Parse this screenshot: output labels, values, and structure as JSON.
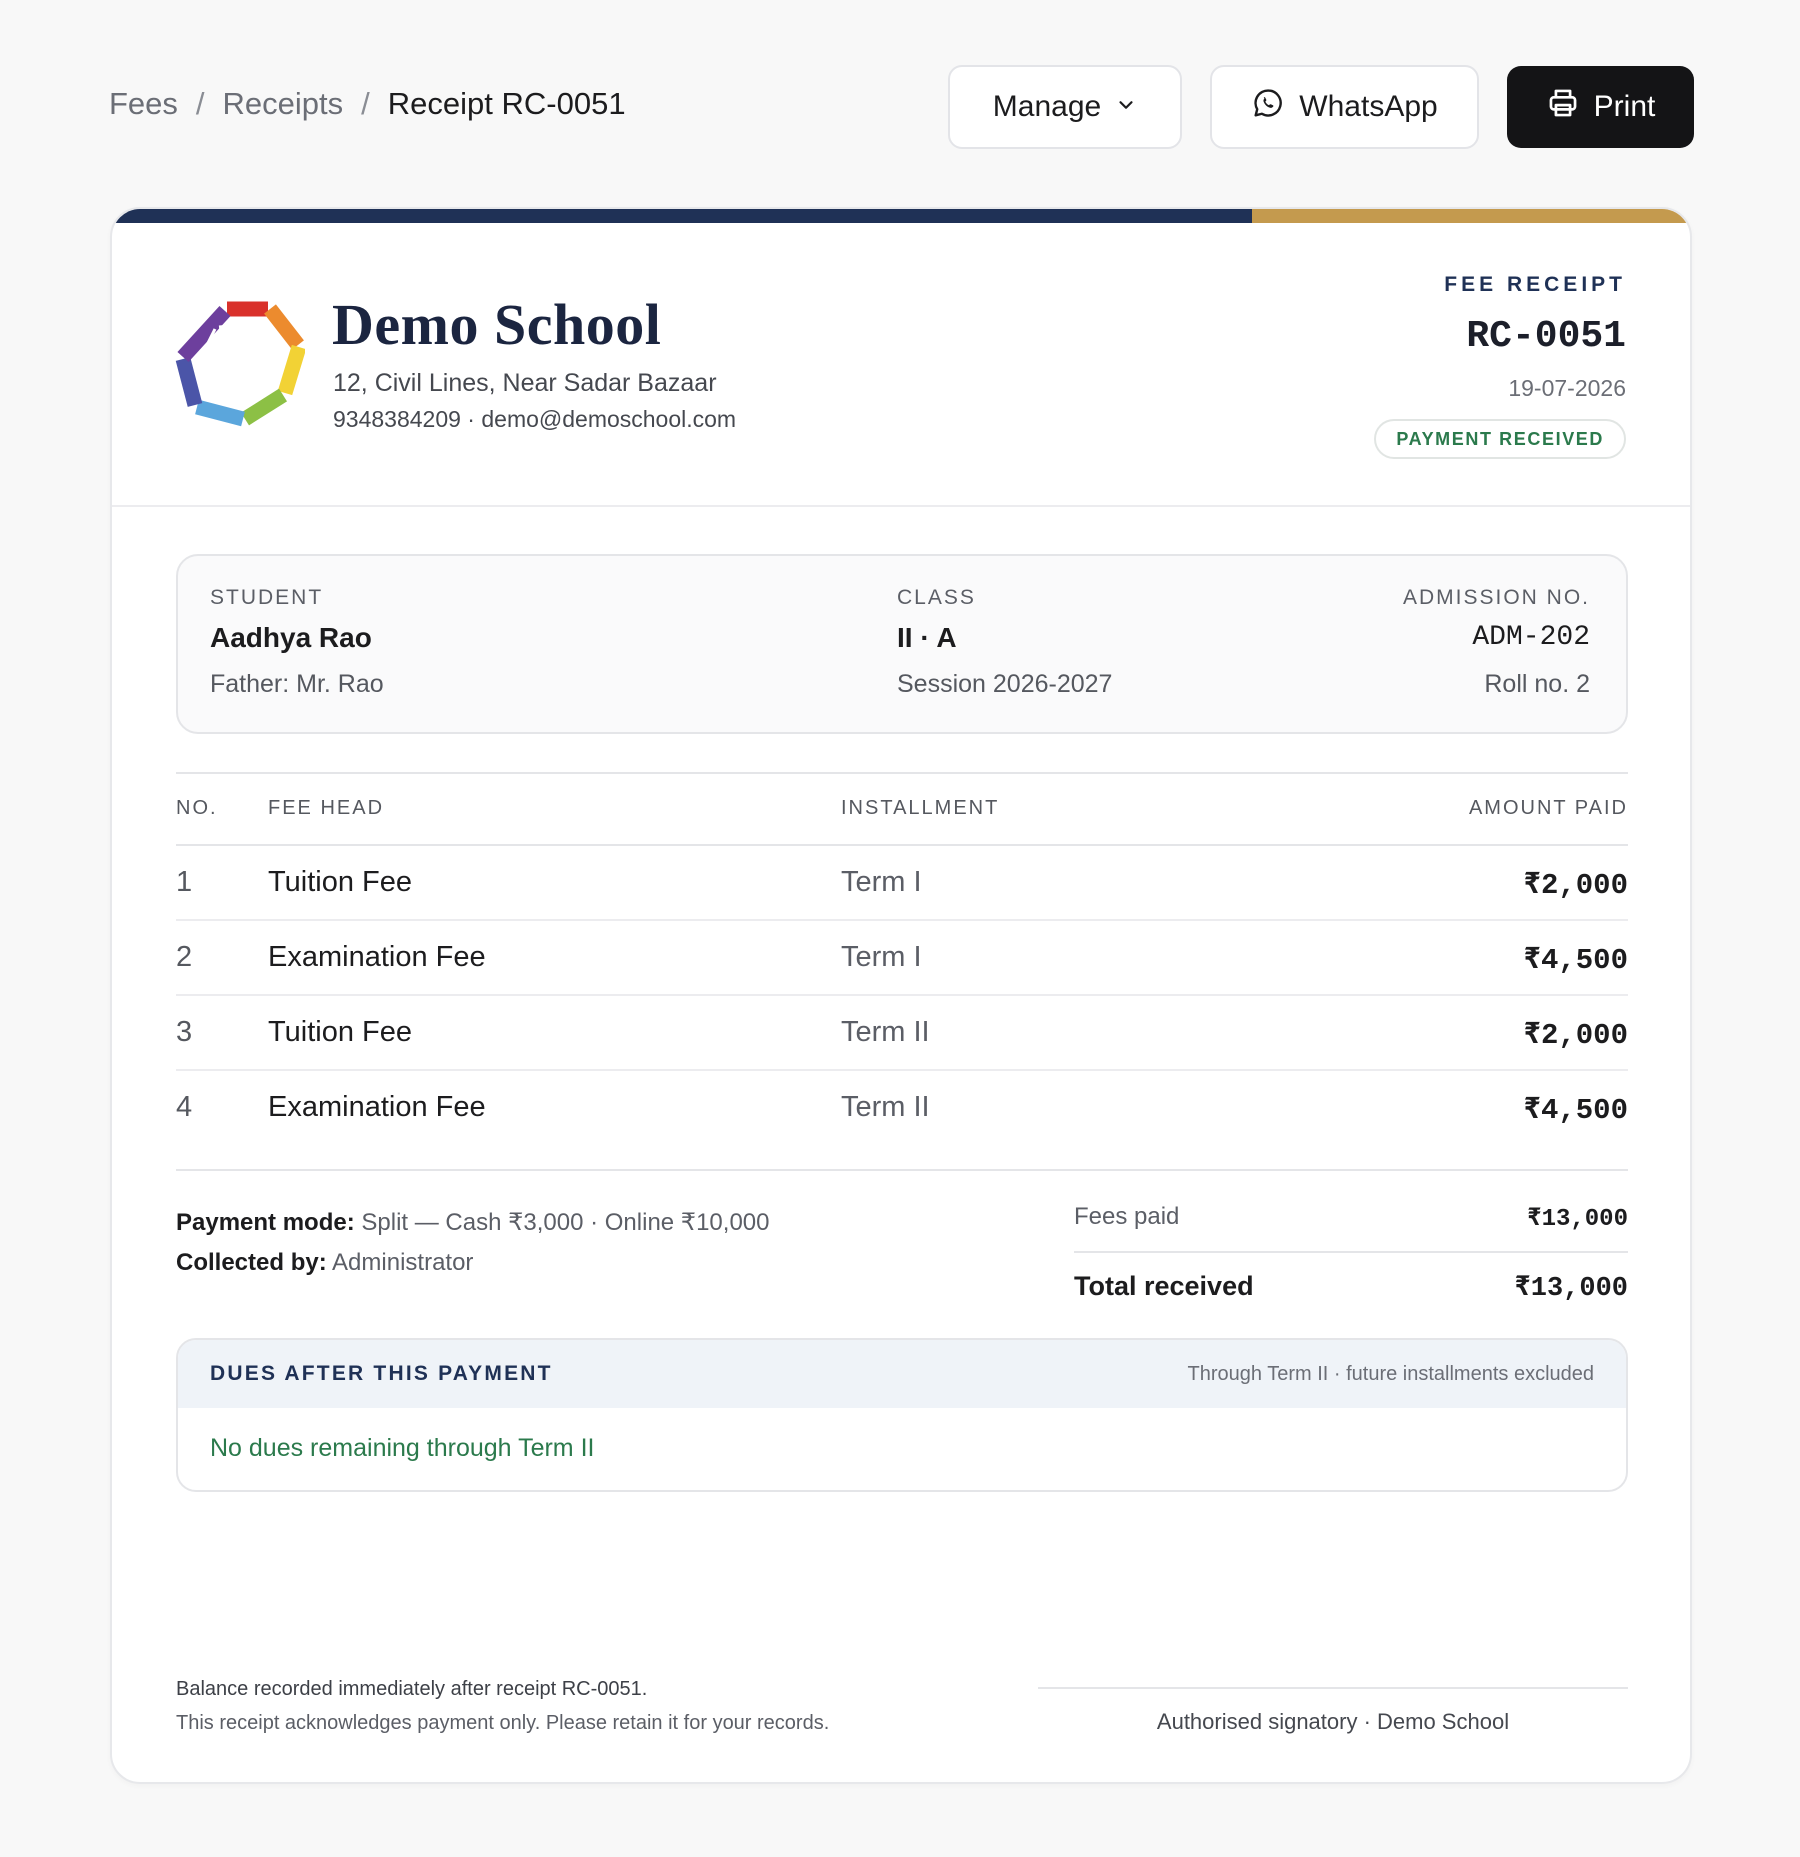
{
  "breadcrumb": {
    "item1": "Fees",
    "item2": "Receipts",
    "current": "Receipt RC-0051",
    "separator": "/"
  },
  "actions": {
    "manage_label": "Manage",
    "whatsapp_label": "WhatsApp",
    "print_label": "Print"
  },
  "icons": {
    "manage": "chevron-down-icon",
    "whatsapp": "whatsapp-icon",
    "print": "printer-icon",
    "logo": "school-logo"
  },
  "colors": {
    "navy": "#1f3156",
    "gold": "#c49a4e",
    "success": "#2b7a4c",
    "print_button": "#141416"
  },
  "school": {
    "name": "Demo School",
    "address": "12, Civil Lines, Near Sadar Bazaar",
    "contact": "9348384209 · demo@demoschool.com"
  },
  "receipt": {
    "label": "FEE RECEIPT",
    "number": "RC-0051",
    "date": "19-07-2026",
    "status": "PAYMENT RECEIVED"
  },
  "student": {
    "label": "STUDENT",
    "name": "Aadhya Rao",
    "father": "Father: Mr. Rao",
    "class_label": "CLASS",
    "class": "II · A",
    "session": "Session 2026-2027",
    "admission_label": "ADMISSION NO.",
    "admission_no": "ADM-202",
    "roll": "Roll no. 2"
  },
  "table": {
    "headers": {
      "no": "NO.",
      "fee_head": "FEE HEAD",
      "installment": "INSTALLMENT",
      "amount": "AMOUNT PAID"
    },
    "rows": [
      {
        "no": "1",
        "fee_head": "Tuition Fee",
        "installment": "Term I",
        "amount": "₹2,000"
      },
      {
        "no": "2",
        "fee_head": "Examination Fee",
        "installment": "Term I",
        "amount": "₹4,500"
      },
      {
        "no": "3",
        "fee_head": "Tuition Fee",
        "installment": "Term II",
        "amount": "₹2,000"
      },
      {
        "no": "4",
        "fee_head": "Examination Fee",
        "installment": "Term II",
        "amount": "₹4,500"
      }
    ]
  },
  "payment": {
    "mode_label": "Payment mode:",
    "mode_value": "Split — Cash ₹3,000 · Online ₹10,000",
    "collected_label": "Collected by:",
    "collected_value": "Administrator"
  },
  "totals": {
    "fees_paid_label": "Fees paid",
    "fees_paid": "₹13,000",
    "total_label": "Total received",
    "total": "₹13,000"
  },
  "dues": {
    "title": "DUES AFTER THIS PAYMENT",
    "note": "Through Term II · future installments excluded",
    "message": "No dues remaining through Term II"
  },
  "footer": {
    "line1": "Balance recorded immediately after receipt RC-0051.",
    "line2": "This receipt acknowledges payment only. Please retain it for your records.",
    "signatory": "Authorised signatory · Demo School"
  }
}
